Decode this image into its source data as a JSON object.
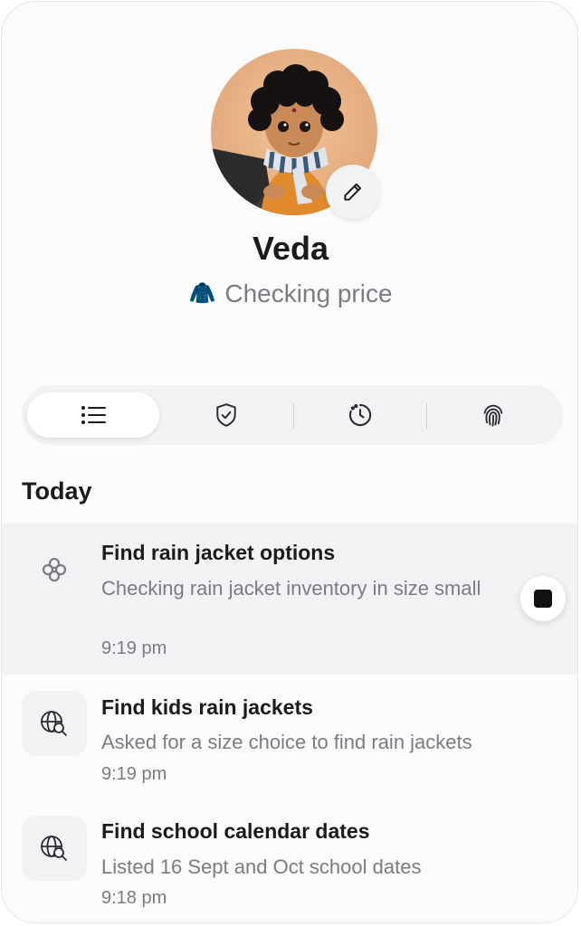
{
  "profile": {
    "name": "Veda",
    "status_emoji": "🧥",
    "status_text": "Checking price"
  },
  "tabs": [
    {
      "icon": "list-icon",
      "active": true
    },
    {
      "icon": "shield-check-icon",
      "active": false
    },
    {
      "icon": "clock-icon",
      "active": false
    },
    {
      "icon": "fingerprint-icon",
      "active": false
    }
  ],
  "section_title": "Today",
  "tasks": [
    {
      "icon": "flower-icon",
      "title": "Find rain jacket options",
      "description": "Checking rain jacket inventory in size small",
      "time": "9:19 pm",
      "in_progress": true
    },
    {
      "icon": "web-search-icon",
      "title": "Find kids rain jackets",
      "description": "Asked for a size choice to find rain jackets",
      "time": "9:19 pm",
      "in_progress": false
    },
    {
      "icon": "web-search-icon",
      "title": "Find school calendar dates",
      "description": "Listed 16 Sept and Oct school dates",
      "time": "9:18 pm",
      "in_progress": false
    }
  ],
  "colors": {
    "accent_dark": "#111111",
    "muted_text": "#7a7c82",
    "surface": "#f0f2f4"
  }
}
